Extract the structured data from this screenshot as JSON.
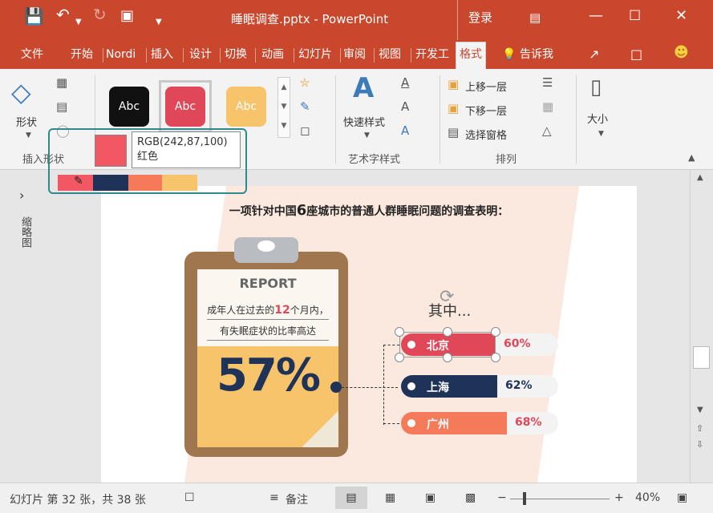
{
  "window": {
    "title": "睡眠调查.pptx  -  PowerPoint",
    "signin": "登录"
  },
  "tabs": [
    {
      "label": "文件"
    },
    {
      "label": "开始"
    },
    {
      "label": "Nordi"
    },
    {
      "label": "插入"
    },
    {
      "label": "设计"
    },
    {
      "label": "切换"
    },
    {
      "label": "动画"
    },
    {
      "label": "幻灯片"
    },
    {
      "label": "审阅"
    },
    {
      "label": "视图"
    },
    {
      "label": "开发工"
    },
    {
      "label": "格式"
    }
  ],
  "tellme": "告诉我",
  "ribbon": {
    "shape_label": "形状",
    "insert_shape_group": "插入形状",
    "style_swatches": [
      {
        "text": "Abc",
        "color": "#111111"
      },
      {
        "text": "Abc",
        "color": "#e0485a"
      },
      {
        "text": "Abc",
        "color": "#f7c36b"
      }
    ],
    "quick_style": "快速样式",
    "art_group": "艺术字样式",
    "bring_forward": "上移一层",
    "send_backward": "下移一层",
    "selection_pane": "选择窗格",
    "arrange_group": "排列",
    "size_label": "大小"
  },
  "popup": {
    "rgb": "RGB(242,87,100)",
    "name": "红色"
  },
  "palette": [
    "#f25764",
    "#1f3257",
    "#f47a5a",
    "#f7c36b"
  ],
  "sidebar": {
    "label": "缩略图"
  },
  "slide": {
    "headline_pre": "一项针对中国",
    "headline_num": "6",
    "headline_post": "座城市的普通人群睡眠问题的调查表明：",
    "report": "REPORT",
    "desc_line1_pre": "成年人在过去的",
    "desc_line1_num": "12",
    "desc_line1_post": "个月内，",
    "desc_line2": "有失眠症状的比率高达",
    "big_percent": "57%",
    "among": "其中...",
    "cities": [
      {
        "name": "北京",
        "percent": "60%",
        "color": "#e0485a",
        "pctcolor": "#e0485a"
      },
      {
        "name": "上海",
        "percent": "62%",
        "color": "#1f3257",
        "pctcolor": "#1f3257"
      },
      {
        "name": "广州",
        "percent": "68%",
        "color": "#f47a5a",
        "pctcolor": "#e0485a"
      }
    ]
  },
  "status": {
    "slide_info": "幻灯片 第 32 张，共 38 张",
    "notes": "备注",
    "zoom": "40%"
  }
}
